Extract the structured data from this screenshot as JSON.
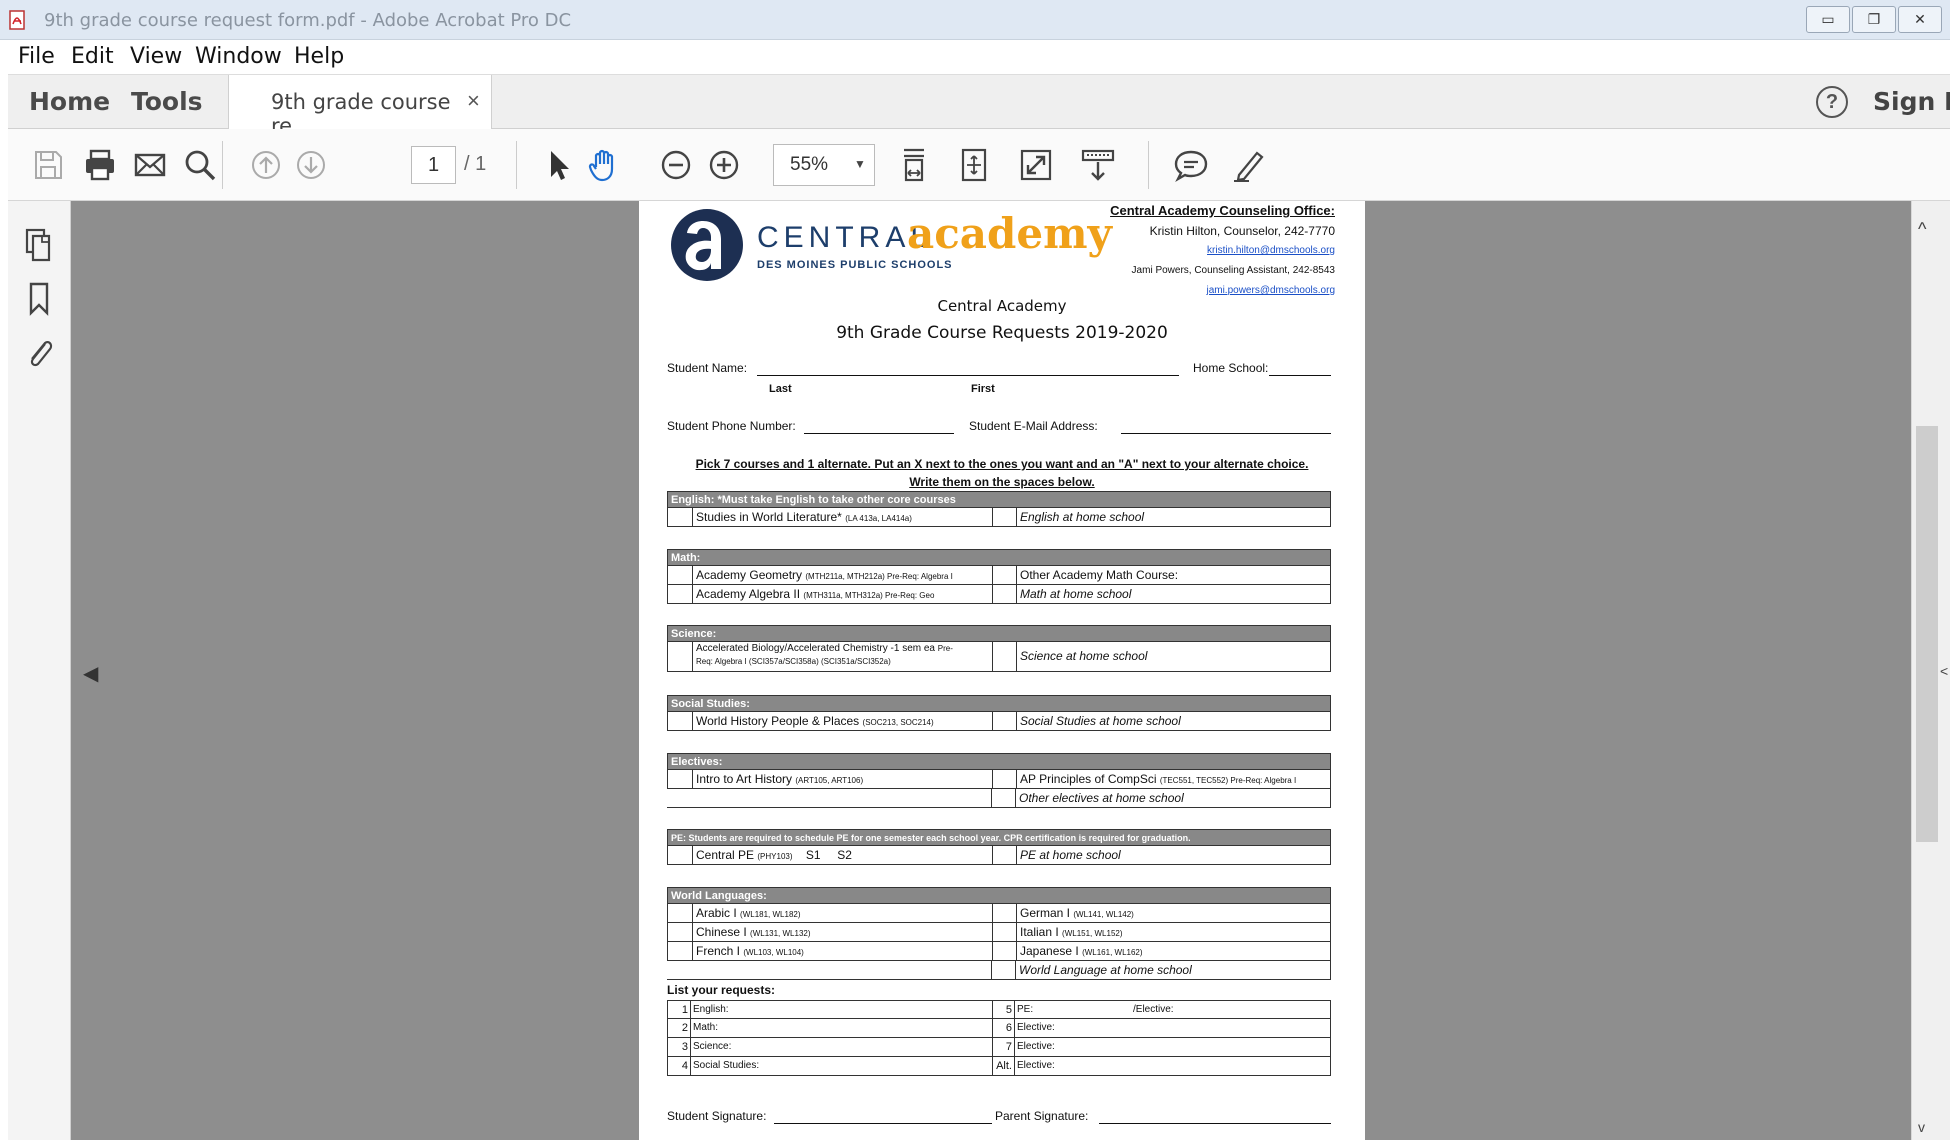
{
  "window": {
    "title": "9th grade course request form.pdf - Adobe Acrobat Pro DC",
    "minimize": "▭",
    "restore": "❐",
    "close": "✕"
  },
  "menu": [
    "File",
    "Edit",
    "View",
    "Window",
    "Help"
  ],
  "tabs": {
    "home": "Home",
    "tools": "Tools",
    "document": "9th grade course re...",
    "close_glyph": "×",
    "help_glyph": "?",
    "sign_in": "Sign In"
  },
  "toolbar": {
    "page_current": "1",
    "page_total": "/ 1",
    "zoom": "55%",
    "zoom_caret": "▼",
    "icons": [
      "save-icon",
      "print-icon",
      "email-icon",
      "search-icon",
      "page-up-icon",
      "page-down-icon",
      "select-arrow-icon",
      "hand-tool-icon",
      "zoom-out-icon",
      "zoom-in-icon",
      "fit-width-icon",
      "fit-page-icon",
      "full-screen-icon",
      "scroll-mode-icon",
      "comment-icon",
      "highlight-pen-icon"
    ]
  },
  "leftrail": {
    "icons": [
      "pages-icon",
      "bookmark-icon",
      "attachment-icon"
    ],
    "collapse_arrow": "◀"
  },
  "scrollbar": {
    "up": "^",
    "down": "v",
    "right": "<"
  },
  "document": {
    "logo": {
      "central": "CENTRAL",
      "academy": "academy",
      "district": "DES MOINES PUBLIC SCHOOLS"
    },
    "counseling": {
      "heading": "Central Academy Counseling Office:",
      "counselor": "Kristin Hilton, Counselor, 242-7770",
      "counselor_email": "kristin.hilton@dmschools.org",
      "assistant": "Jami Powers, Counseling Assistant, 242-8543",
      "assistant_email": "jami.powers@dmschools.org"
    },
    "title1": "Central Academy",
    "title2": "9th Grade Course Requests 2019-2020",
    "fields": {
      "student_name": "Student Name:",
      "last": "Last",
      "first": "First",
      "home_school": "Home School:",
      "phone": "Student Phone Number:",
      "email": "Student E-Mail Address:"
    },
    "instructions1": "Pick 7 courses and 1 alternate. Put an X next to the ones you want and an \"A\" next to your alternate choice.",
    "instructions2": "Write them on the spaces below.",
    "sections": {
      "english": {
        "head": "English: *Must take English to take other core courses",
        "rows": [
          {
            "left": "Studies in World Literature*",
            "left_code": "(LA 413a, LA414a)",
            "right": "English at home school"
          }
        ]
      },
      "math": {
        "head": "Math:",
        "rows": [
          {
            "left": "Academy Geometry",
            "left_code": "(MTH211a, MTH212a) Pre-Req: Algebra I",
            "right": "Other Academy Math Course:"
          },
          {
            "left": "Academy Algebra II",
            "left_code": "(MTH311a, MTH312a) Pre-Req: Geo",
            "right": "Math at home school"
          }
        ]
      },
      "science": {
        "head": "Science:",
        "rows": [
          {
            "left": "Accelerated Biology/Accelerated Chemistry -1 sem ea",
            "left_code": "Pre-",
            "left_line2": "Req: Algebra I (SCI357a/SCI358a) (SCI351a/SCI352a)",
            "right": "Science at home school"
          }
        ]
      },
      "social": {
        "head": "Social Studies:",
        "rows": [
          {
            "left": "World History People & Places",
            "left_code": "(SOC213, SOC214)",
            "right": "Social Studies at home school"
          }
        ]
      },
      "electives": {
        "head": "Electives:",
        "rows": [
          {
            "left": "Intro to Art History",
            "left_code": "(ART105, ART106)",
            "right": "AP Principles of CompSci",
            "right_code": "(TEC551, TEC552) Pre-Req: Algebra I"
          },
          {
            "left": "",
            "left_code": "",
            "right": "Other electives at home school"
          }
        ]
      },
      "pe": {
        "head": "PE: Students are required to schedule PE for one semester each school year. CPR certification is required for graduation.",
        "rows": [
          {
            "left": "Central PE",
            "left_code": "(PHY103)",
            "s1": "S1",
            "s2": "S2",
            "right": "PE at home school"
          }
        ]
      },
      "languages": {
        "head": "World Languages:",
        "rows": [
          {
            "left": "Arabic I",
            "left_code": "(WL181, WL182)",
            "right": "German I",
            "right_code": "(WL141, WL142)"
          },
          {
            "left": "Chinese I",
            "left_code": "(WL131, WL132)",
            "right": "Italian I",
            "right_code": "(WL151, WL152)"
          },
          {
            "left": "French I",
            "left_code": "(WL103, WL104)",
            "right": "Japanese I",
            "right_code": "(WL161, WL162)"
          },
          {
            "left": "",
            "left_code": "",
            "right": "World Language at home school",
            "right_code": ""
          }
        ]
      }
    },
    "list": {
      "heading": "List your requests:",
      "rows": [
        {
          "ln": "1",
          "lt": "English:",
          "rn": "5",
          "rt": "PE:",
          "rt2": "/Elective:"
        },
        {
          "ln": "2",
          "lt": "Math:",
          "rn": "6",
          "rt": "Elective:",
          "rt2": ""
        },
        {
          "ln": "3",
          "lt": "Science:",
          "rn": "7",
          "rt": "Elective:",
          "rt2": ""
        },
        {
          "ln": "4",
          "lt": "Social Studies:",
          "rn": "Alt.",
          "rt": "Elective:",
          "rt2": ""
        }
      ]
    },
    "student_signature": "Student Signature:",
    "parent_signature": "Parent Signature:"
  }
}
